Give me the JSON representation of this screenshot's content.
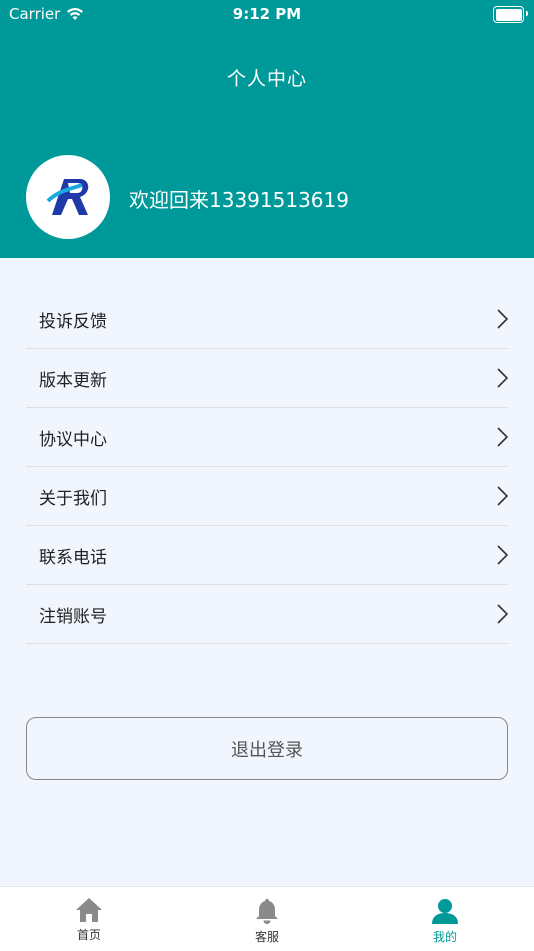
{
  "status_bar": {
    "carrier": "Carrier",
    "time": "9:12 PM",
    "wifi_icon": "wifi-icon",
    "battery_icon": "battery-icon"
  },
  "header": {
    "title": "个人中心",
    "welcome_text": "欢迎回来13391513619",
    "background_color": "#00999a"
  },
  "menu": {
    "items": [
      {
        "label": "投诉反馈",
        "icon": "chevron-right-icon"
      },
      {
        "label": "版本更新",
        "icon": "chevron-right-icon"
      },
      {
        "label": "协议中心",
        "icon": "chevron-right-icon"
      },
      {
        "label": "关于我们",
        "icon": "chevron-right-icon"
      },
      {
        "label": "联系电话",
        "icon": "chevron-right-icon"
      },
      {
        "label": "注销账号",
        "icon": "chevron-right-icon"
      }
    ]
  },
  "logout": {
    "label": "退出登录"
  },
  "tabbar": {
    "items": [
      {
        "label": "首页",
        "icon": "home-icon",
        "active": false
      },
      {
        "label": "客服",
        "icon": "bell-icon",
        "active": false
      },
      {
        "label": "我的",
        "icon": "user-icon",
        "active": true
      }
    ],
    "active_color": "#00999a",
    "inactive_icon_color": "#8a8a8a"
  }
}
